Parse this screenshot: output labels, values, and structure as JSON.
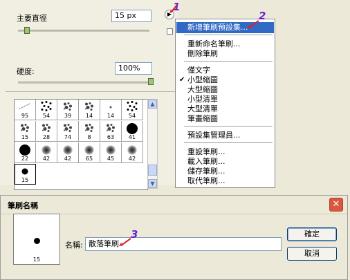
{
  "brush_panel": {
    "diameter_label": "主要直徑",
    "diameter_value": "15 px",
    "hardness_label": "硬度:",
    "hardness_value": "100%",
    "menu_icon": "right-arrow-circle-icon",
    "brushes": [
      {
        "size": "95",
        "shape": "line"
      },
      {
        "size": "54",
        "shape": "dots"
      },
      {
        "size": "39",
        "shape": "splatter"
      },
      {
        "size": "14",
        "shape": "splatter"
      },
      {
        "size": "14",
        "shape": "dot-small"
      },
      {
        "size": "54",
        "shape": "dots"
      },
      {
        "size": "15",
        "shape": "splatter"
      },
      {
        "size": "28",
        "shape": "splatter"
      },
      {
        "size": "74",
        "shape": "splatter"
      },
      {
        "size": "8",
        "shape": "splatter"
      },
      {
        "size": "63",
        "shape": "splatter"
      },
      {
        "size": "41",
        "shape": "solid-large"
      },
      {
        "size": "22",
        "shape": "solid-large"
      },
      {
        "size": "42",
        "shape": "soft"
      },
      {
        "size": "42",
        "shape": "soft"
      },
      {
        "size": "65",
        "shape": "soft"
      },
      {
        "size": "45",
        "shape": "soft"
      },
      {
        "size": "42",
        "shape": "soft"
      },
      {
        "size": "15",
        "shape": "solid-medium"
      }
    ]
  },
  "context_menu": {
    "items": [
      {
        "label": "新增筆刷預設集...",
        "highlighted": true,
        "checked": false
      },
      {
        "label": "重新命名筆刷...",
        "highlighted": false,
        "checked": false
      },
      {
        "label": "刪除筆刷",
        "highlighted": false,
        "checked": false
      },
      {
        "label": "僅文字",
        "highlighted": false,
        "checked": false
      },
      {
        "label": "小型縮圖",
        "highlighted": false,
        "checked": true
      },
      {
        "label": "大型縮圖",
        "highlighted": false,
        "checked": false
      },
      {
        "label": "小型清單",
        "highlighted": false,
        "checked": false
      },
      {
        "label": "大型清單",
        "highlighted": false,
        "checked": false
      },
      {
        "label": "筆畫縮圖",
        "highlighted": false,
        "checked": false
      },
      {
        "label": "預設集管理員...",
        "highlighted": false,
        "checked": false
      },
      {
        "label": "重設筆刷...",
        "highlighted": false,
        "checked": false
      },
      {
        "label": "載入筆刷...",
        "highlighted": false,
        "checked": false
      },
      {
        "label": "儲存筆刷...",
        "highlighted": false,
        "checked": false
      },
      {
        "label": "取代筆刷...",
        "highlighted": false,
        "checked": false
      }
    ],
    "check_glyph": "✔"
  },
  "dialog": {
    "title": "筆刷名稱",
    "close_glyph": "✕",
    "preview_size": "15",
    "name_label": "名稱:",
    "name_value": "散落筆刷",
    "ok_label": "確定",
    "cancel_label": "取消"
  },
  "annotations": {
    "step1": "1",
    "step2": "2",
    "step3": "3"
  },
  "colors": {
    "highlight": "#316ac5",
    "annotation": "#6a1fd2",
    "arrow": "#e0202a"
  }
}
